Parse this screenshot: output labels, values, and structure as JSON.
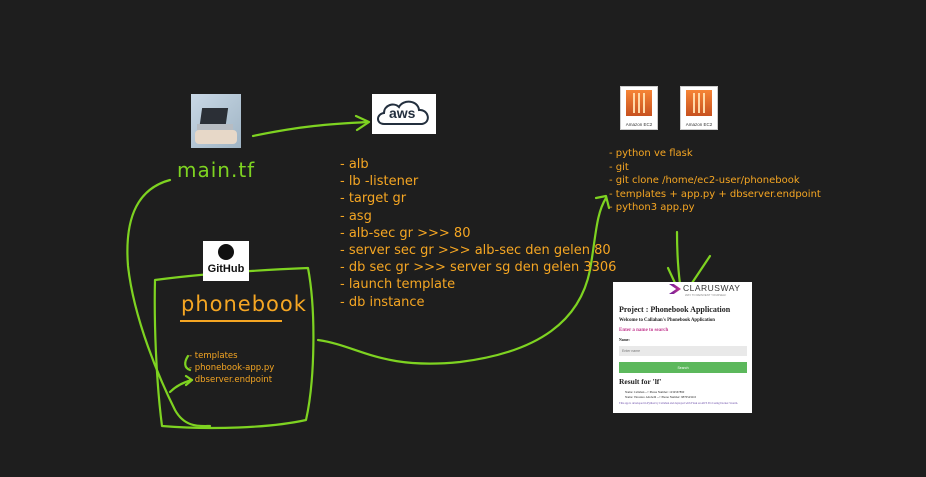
{
  "main_tf": {
    "label": "main.tf"
  },
  "aws": {
    "logo_text": "aws",
    "items": [
      "- alb",
      "- lb -listener",
      "- target gr",
      "- asg",
      "- alb-sec gr >>> 80",
      "- server sec gr >>> alb-sec den gelen 80",
      "- db sec gr >>> server sg den gelen 3306",
      "- launch template",
      "- db instance"
    ]
  },
  "ec2": {
    "icon_caption_1": "Amazon EC2",
    "icon_caption_2": "Amazon EC2",
    "items": [
      "- python ve flask",
      "- git",
      "- git clone /home/ec2-user/phonebook",
      "- templates + app.py + dbserver.endpoint",
      "- python3 app.py"
    ]
  },
  "github": {
    "logo_text": "GitHub",
    "repo": "phonebook",
    "items": [
      "- templates",
      "- phonebook-app.py",
      "- dbserver.endpoint"
    ]
  },
  "app": {
    "brand": "CLARUSWAY",
    "brand_tagline": "WAY TO REINVENT YOURSELF",
    "title": "Project : Phonebook Application",
    "welcome": "Welcome to Callahan's Phonebook Application",
    "prompt": "Enter a name to search",
    "name_label": "Name:",
    "name_placeholder": "Enter name",
    "search_button": "Search",
    "result_title": "Result for 'lf'",
    "results": [
      "Name: Callahan --> Phone Number: 1234567890",
      "Name: Vincenzo Altobelli --> Phone Number: 9876543210"
    ],
    "footer": "This app is developed in Python by Callahan and deployed with Flask on AWS EC2 using Docker Swarm."
  },
  "colors": {
    "background": "#1e1e1e",
    "handwriting_orange": "#f5a623",
    "handwriting_green": "#7ed321",
    "ec2_orange": "#e8742a",
    "app_heading_pink": "#c2368d",
    "app_button_green": "#5cb85c"
  }
}
